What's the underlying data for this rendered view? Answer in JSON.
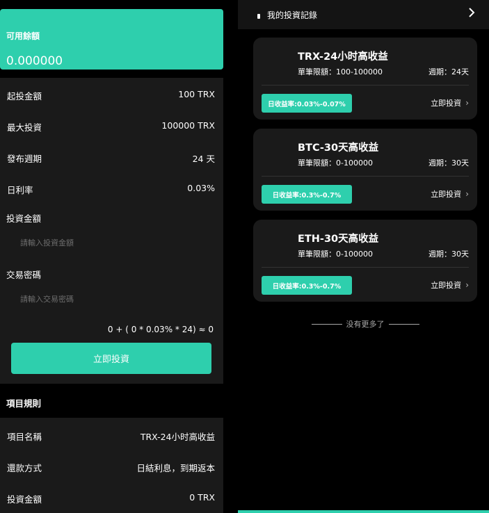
{
  "left": {
    "balance": {
      "label": "可用餘額",
      "value": "0.000000"
    },
    "info_rows": [
      {
        "label": "起投金額",
        "value": "100 TRX"
      },
      {
        "label": "最大投資",
        "value": "100000 TRX"
      },
      {
        "label": "發布週期",
        "value": "24 天"
      },
      {
        "label": "日利率",
        "value": "0.03%"
      }
    ],
    "amount": {
      "label": "投資金額",
      "placeholder": "請輸入投資金額"
    },
    "password": {
      "label": "交易密碼",
      "placeholder": "請輸入交易密碼"
    },
    "formula": "0 + ( 0 * 0.03% * 24) ≈ 0",
    "invest_button": "立即投資",
    "rules": {
      "title": "項目規則",
      "rows": [
        {
          "label": "項目名稱",
          "value": "TRX-24小时高收益"
        },
        {
          "label": "還款方式",
          "value": "日結利息，到期返本"
        },
        {
          "label": "投資金額",
          "value": "0 TRX"
        }
      ]
    }
  },
  "right": {
    "header": {
      "title": "我的投資記錄",
      "icon": "chevron-right-icon"
    },
    "products": [
      {
        "title": "TRX-24小时高收益",
        "limit": "單筆限額：100-100000",
        "period": "週期：24天",
        "rate": "日收益率:0.03%-0.07%",
        "action": "立即投資"
      },
      {
        "title": "BTC-30天高收益",
        "limit": "單筆限額：0-100000",
        "period": "週期：30天",
        "rate": "日收益率:0.3%-0.7%",
        "action": "立即投資"
      },
      {
        "title": "ETH-30天高收益",
        "limit": "單筆限額：0-100000",
        "period": "週期：30天",
        "rate": "日收益率:0.3%-0.7%",
        "action": "立即投資"
      }
    ],
    "no_more": "没有更多了"
  },
  "colors": {
    "accent": "#2ecfad",
    "panel": "#1a1a1a",
    "background": "#000000"
  }
}
